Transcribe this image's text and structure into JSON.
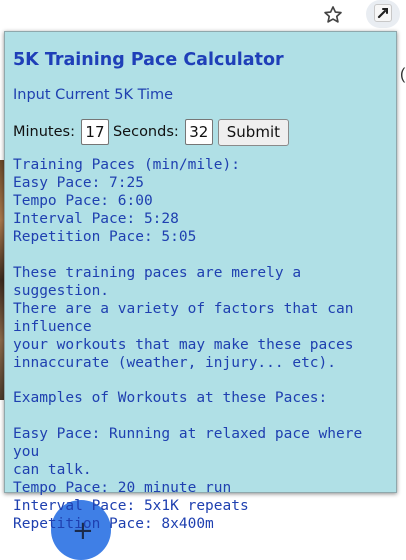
{
  "browser": {
    "star_icon": "star-outline-icon",
    "extension_icon": "puzzle-extension-icon"
  },
  "background": {
    "right_text": "(",
    "fab_label": "+"
  },
  "popup": {
    "title": "5K Training Pace Calculator",
    "subtitle": "Input Current 5K Time",
    "form": {
      "minutes_label": "Minutes:",
      "minutes_value": "17",
      "seconds_label": "Seconds:",
      "seconds_value": "32",
      "submit_label": "Submit"
    },
    "paces": {
      "heading": "Training Paces (min/mile):",
      "easy": "Easy Pace: 7:25",
      "tempo": "Tempo Pace: 6:00",
      "interval": "Interval Pace: 5:28",
      "repetition": "Repetition Pace: 5:05"
    },
    "disclaimer": [
      "These training paces are merely a suggestion.",
      "There are a variety of factors that can influence",
      "your workouts that may make these paces",
      "innaccurate (weather, injury... etc)."
    ],
    "examples_heading": "Examples of Workouts at these Paces:",
    "examples": {
      "easy_line1": "Easy Pace: Running at relaxed pace where you",
      "easy_line2": "can talk.",
      "tempo": "Tempo Pace: 20 minute run",
      "interval": "Interval Pace: 5x1K repeats",
      "repetition": "Repetition Pace: 8x400m"
    }
  },
  "colors": {
    "popup_background": "#b0e0e6",
    "text_blue": "#1f40b0"
  }
}
